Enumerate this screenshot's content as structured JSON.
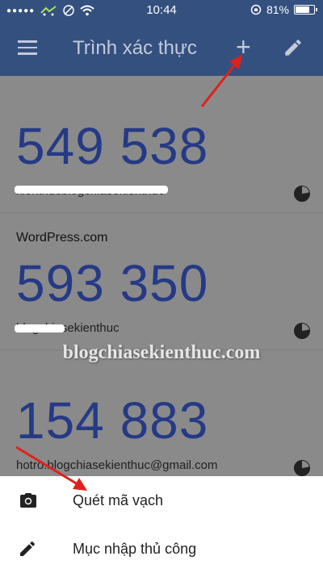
{
  "status_bar": {
    "time": "10:44",
    "battery": "81%",
    "battery_level": 0.81
  },
  "app_bar": {
    "title": "Trình xác thực",
    "menu_icon": "hamburger-menu-icon",
    "add_icon": "plus-icon",
    "edit_icon": "pencil-icon",
    "color": "#34507f"
  },
  "accounts": [
    {
      "issuer": "",
      "code": "549 538",
      "account": "kienthucblogchiasekienthuc"
    },
    {
      "issuer": "WordPress.com",
      "code": "593 350",
      "account": "blogchiasekienthuc"
    },
    {
      "issuer": "",
      "code": "154 883",
      "account": "hotro.blogchiasekienthuc@gmail.com"
    }
  ],
  "watermark": "blogchiasekienthuc.com",
  "bottom_sheet": {
    "scan_label": "Quét mã vạch",
    "manual_label": "Mục nhập thủ công"
  },
  "colors": {
    "code": "#253a86",
    "arrow": "#e0201c"
  }
}
